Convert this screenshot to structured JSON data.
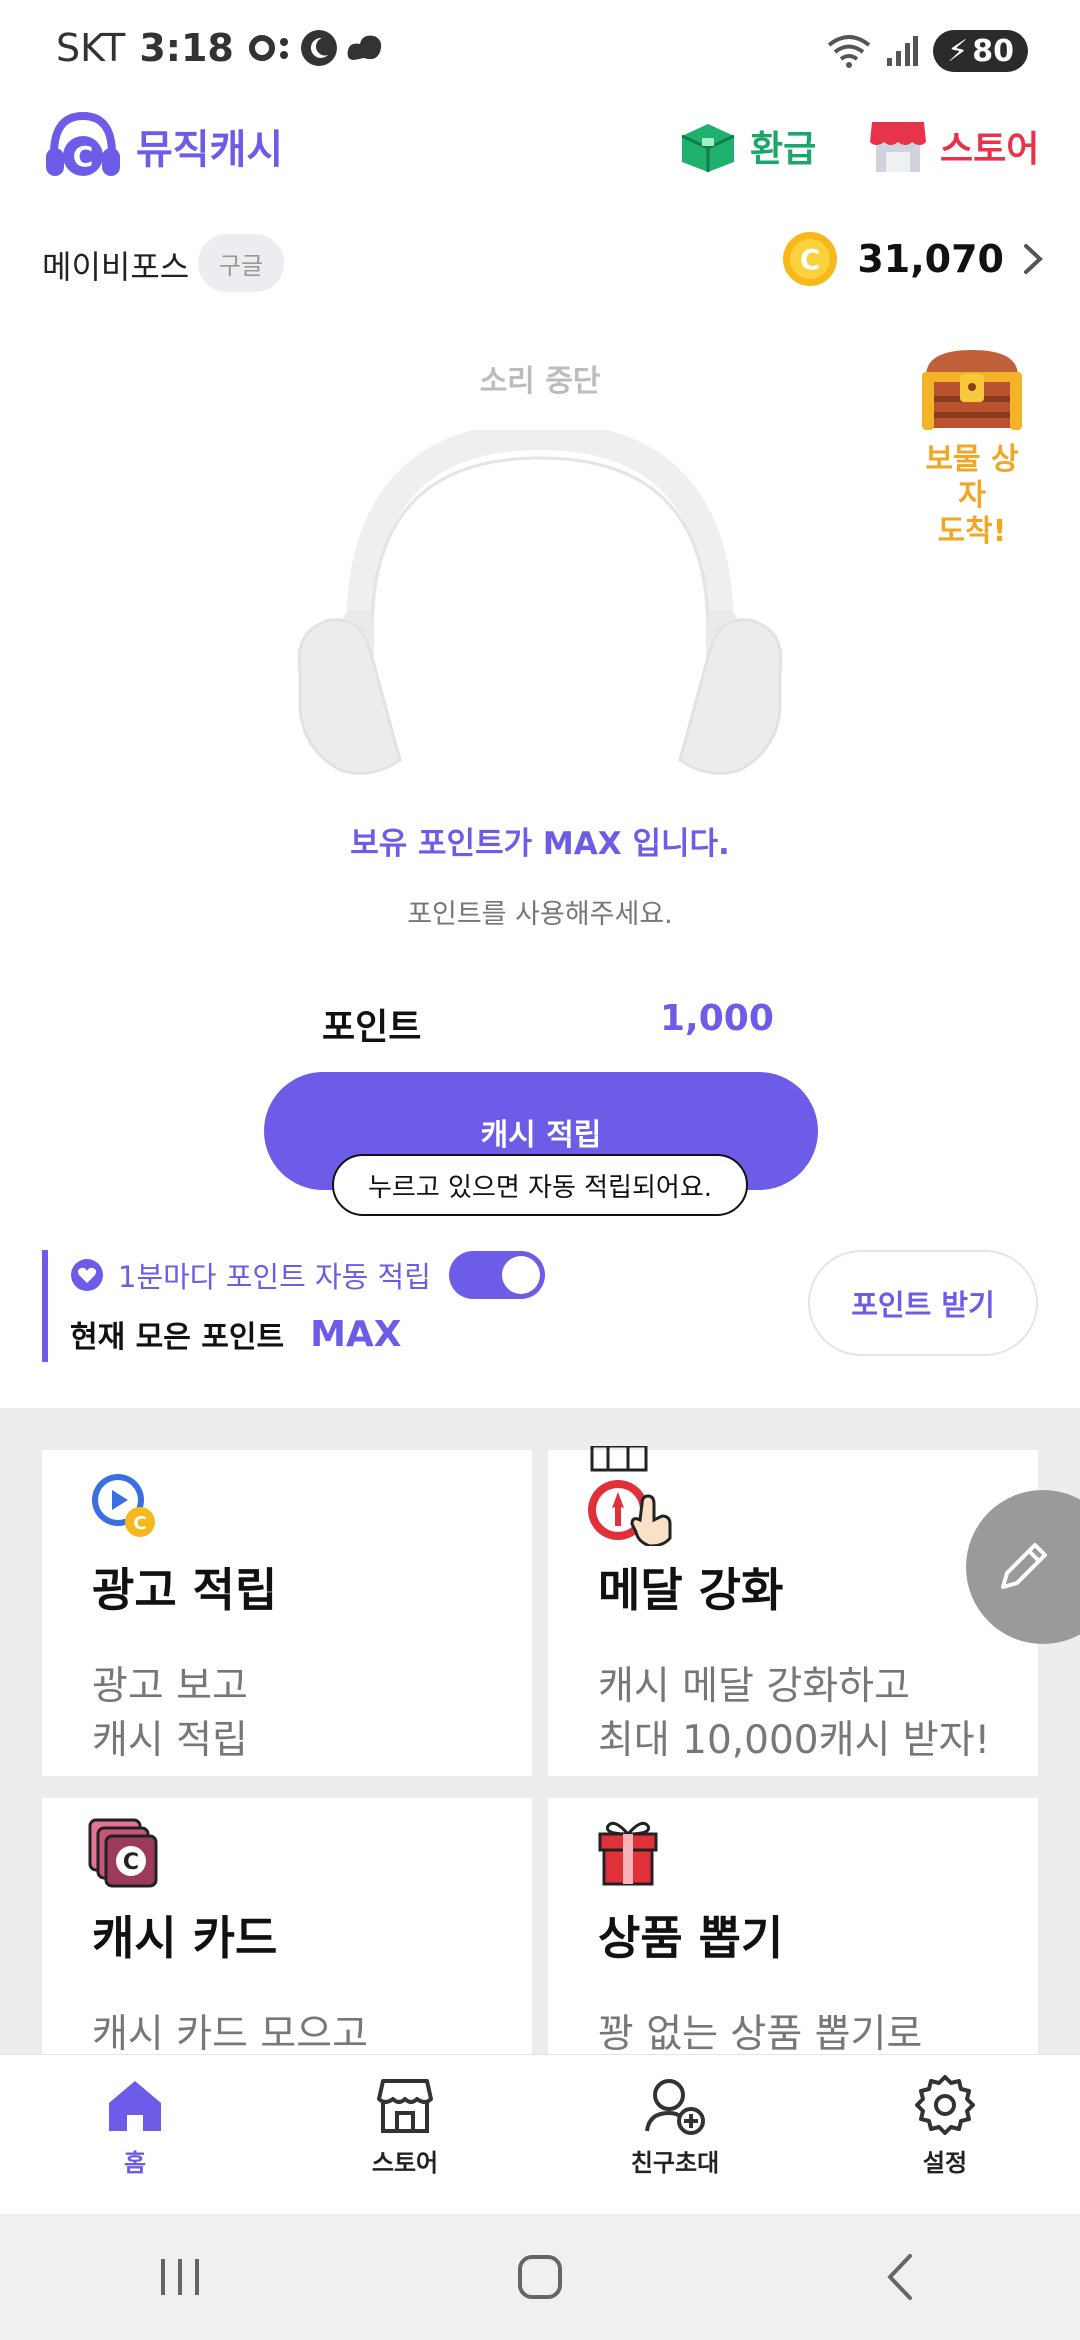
{
  "status_bar": {
    "carrier": "SKT",
    "time": "3:18",
    "battery": "80"
  },
  "header": {
    "app_name": "뮤직캐시",
    "refund_label": "환급",
    "store_label": "스토어"
  },
  "user": {
    "name": "메이비포스",
    "login_badge": "구글",
    "coins": "31,070"
  },
  "player": {
    "sound_status": "소리 중단",
    "treasure_label_line1": "보물 상자",
    "treasure_label_line2": "도착!",
    "max_message": "보유 포인트가 MAX 입니다.",
    "use_message": "포인트를 사용해주세요.",
    "point_label": "포인트",
    "point_value": "1,000",
    "cash_button": "캐시 적립",
    "tooltip": "누르고 있으면 자동 적립되어요.",
    "auto_text": "1분마다 포인트 자동 적립",
    "auto_enabled": true,
    "collected_label": "현재 모은 포인트",
    "collected_value": "MAX",
    "receive_button": "포인트 받기"
  },
  "cards": [
    {
      "title": "광고 적립",
      "desc_line1": "광고 보고",
      "desc_line2": "캐시 적립",
      "icon": "ad-play-icon"
    },
    {
      "title": "메달 강화",
      "desc_line1": "캐시 메달 강화하고",
      "desc_line2": "최대 10,000캐시 받자!",
      "icon": "medal-icon"
    },
    {
      "title": "캐시 카드",
      "desc_line1": "캐시 카드 모으고",
      "desc_line2": "",
      "icon": "cash-card-icon"
    },
    {
      "title": "상품 뽑기",
      "desc_line1": "꽝 없는 상품 뽑기로",
      "desc_line2": "",
      "icon": "gift-icon"
    }
  ],
  "bottom_nav": [
    {
      "label": "홈",
      "icon": "home-icon",
      "active": true
    },
    {
      "label": "스토어",
      "icon": "store-icon",
      "active": false
    },
    {
      "label": "친구초대",
      "icon": "invite-friend-icon",
      "active": false
    },
    {
      "label": "설정",
      "icon": "settings-icon",
      "active": false
    }
  ],
  "colors": {
    "accent": "#6c5ce7",
    "refund": "#1aa86a",
    "store": "#e8344a",
    "treasure": "#f2a623"
  }
}
